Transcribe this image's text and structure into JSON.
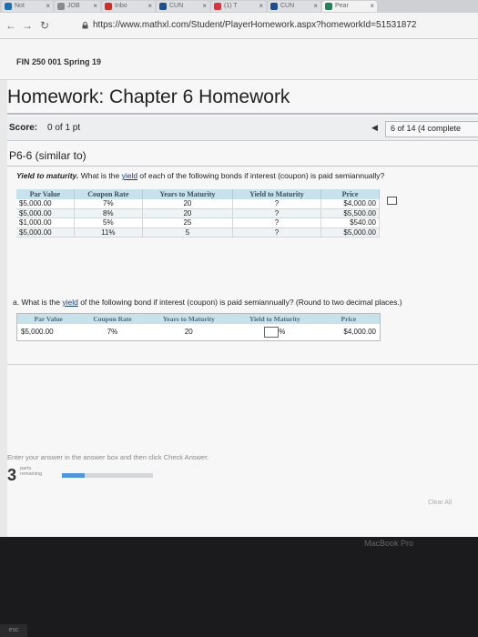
{
  "browser": {
    "tabs": [
      {
        "label": "Not",
        "icon_color": "#1f6fb5",
        "active": false
      },
      {
        "label": "JOB",
        "icon_color": "#8a8a8a",
        "active": false
      },
      {
        "label": "Inbo",
        "icon_color": "#c9302c",
        "active": false
      },
      {
        "label": "CUN",
        "icon_color": "#1f4e8c",
        "active": false
      },
      {
        "label": "(1) T",
        "icon_color": "#d9363e",
        "active": false
      },
      {
        "label": "CUN",
        "icon_color": "#1f4e8c",
        "active": false
      },
      {
        "label": "Pear",
        "icon_color": "#2a7d5a",
        "active": true
      }
    ],
    "url": "https://www.mathxl.com/Student/PlayerHomework.aspx?homeworkId=51531872"
  },
  "course": {
    "title": "FIN 250 001 Spring 19"
  },
  "homework": {
    "title": "Homework: Chapter 6 Homework",
    "score_label": "Score:",
    "score_value": "0 of 1 pt",
    "pager": "6 of 14 (4 complete"
  },
  "problem": {
    "id": "P6-6 (similar to)",
    "question_lead": "Yield to maturity.",
    "question_pre": " What is the ",
    "question_link": "yield",
    "question_post": " of each of the following bonds if interest (coupon) is paid semiannually?",
    "table": {
      "headers": [
        "Par Value",
        "Coupon Rate",
        "Years to Maturity",
        "Yield to Maturity",
        "Price"
      ],
      "rows": [
        [
          "$5,000.00",
          "7%",
          "20",
          "?",
          "$4,000.00"
        ],
        [
          "$5,000.00",
          "8%",
          "20",
          "?",
          "$5,500.00"
        ],
        [
          "$1,000.00",
          "5%",
          "25",
          "?",
          "$540.00"
        ],
        [
          "$5,000.00",
          "11%",
          "5",
          "?",
          "$5,000.00"
        ]
      ]
    },
    "part_a_pre": "a. What is the ",
    "part_a_link": "yield",
    "part_a_post": " of the following bond if interest (coupon) is paid semiannually?  (Round to two decimal places.)",
    "answer_table": {
      "headers": [
        "Par Value",
        "Coupon Rate",
        "Years to Maturity",
        "Yield to Maturity",
        "Price"
      ],
      "row": {
        "par": "$5,000.00",
        "coupon": "7%",
        "years": "20",
        "yield_unit": "%",
        "price": "$4,000.00"
      }
    }
  },
  "footer": {
    "instructions": "Enter your answer in the answer box and then click Check Answer.",
    "parts_count": "3",
    "parts_label_1": "parts",
    "parts_label_2": "remaining",
    "parts_progress": 0.25,
    "clear_all": "Clear All"
  },
  "bezel": {
    "label": "MacBook Pro"
  },
  "keyboard": {
    "esc": "esc"
  }
}
